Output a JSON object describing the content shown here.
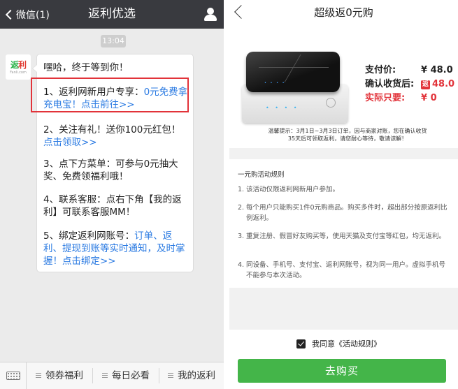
{
  "chat": {
    "header": {
      "back_label": "微信(1)",
      "title": "返利优选"
    },
    "time": "13:04",
    "avatar": {
      "logo_a": "返",
      "logo_b": "利",
      "domain": "Fanli.com"
    },
    "messages": [
      {
        "text": "嘿哈，终于等到你！"
      },
      {
        "text": "1、返利网新用户专享：",
        "link": "0元免费拿充电宝！点击前往>>",
        "highlighted": true
      },
      {
        "text": "2、关注有礼！送你100元红包！",
        "link": "点击领取>>"
      },
      {
        "text": "3、点下方菜单：可参与0元抽大奖、免费领福利哦！"
      },
      {
        "text": "4、联系客服：点右下角【我的返利】可联系客服MM！"
      },
      {
        "text": "5、绑定返利网账号：",
        "link": "订单、返利、提现到账等实时通知，及时掌握！点击绑定>>"
      }
    ],
    "bottom_menu": [
      "领券福利",
      "每日必看",
      "我的返利"
    ]
  },
  "product_page": {
    "title": "超级返0元购",
    "prices": {
      "pay_label": "支付价:",
      "pay_value": "¥ 48.0",
      "receipt_label": "确认收货后:",
      "receipt_tag": "返",
      "receipt_value": "48.0",
      "actual_label": "实际只要:",
      "actual_value": "¥ 0"
    },
    "note_line1": "温馨提示：3月1日~3月3日订单，因与商家对账，您在确认收货",
    "note_line2": "35天后可领取返利，请您耐心等待，敬请谅解！",
    "rules_title": "一元购活动规则",
    "rules": [
      {
        "num": "1.",
        "text": "该活动仅限返利网新用户参加。"
      },
      {
        "num": "2.",
        "text": "每个用户只能购买1件0元购商品。购买多件时，超出部分按原返利比例返利。"
      },
      {
        "num": "3.",
        "text": "重复注册、假冒好友购买等，使用天猫及支付宝等红包，均无返利。"
      },
      {
        "num": "4.",
        "text": "同设备、手机号、支付宝、返利网账号，视为同一用户。虚拟手机号不能参与本次活动。"
      }
    ],
    "agree_label": "我同意《活动规则》",
    "buy_label": "去购买"
  },
  "colors": {
    "wechat_bar": "#393a3f",
    "link": "#2a7ae2",
    "highlight": "#e2333a",
    "buy_button": "#44b549"
  }
}
